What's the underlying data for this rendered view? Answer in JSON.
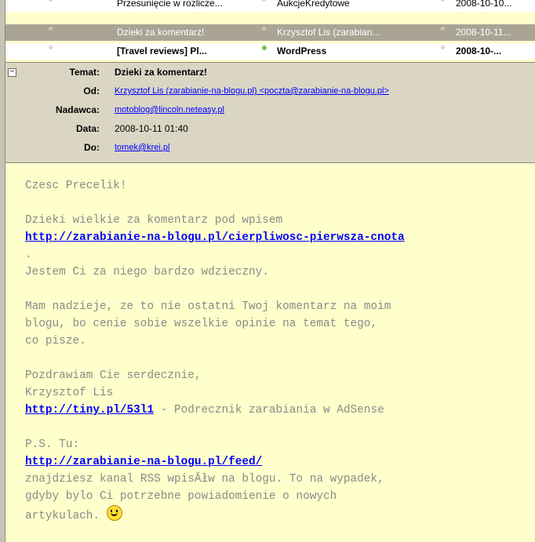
{
  "message_list": [
    {
      "subject": "Przesunięcie w rozlicze...",
      "from": "AukcjeKredytowe",
      "date": "2008-10-10...",
      "unread": false
    },
    {
      "subject": "Dzieki za komentarz!",
      "from": "Krzysztof Lis (zarabian...",
      "date": "2008-10-11...",
      "selected": true
    },
    {
      "subject": "[Travel reviews] Pl...",
      "from": "WordPress",
      "date": "2008-10-...",
      "unread": true
    }
  ],
  "header": {
    "temat_label": "Temat:",
    "temat": "Dzieki za komentarz!",
    "od_label": "Od:",
    "od": "Krzysztof Lis (zarabianie-na-blogu.pl) <poczta@zarabianie-na-blogu.pl>",
    "nadawca_label": "Nadawca:",
    "nadawca": "motoblog@lincoln.neteasy.pl",
    "data_label": "Data:",
    "data": "2008-10-11 01:40",
    "do_label": "Do:",
    "do": "tomek@krei.pl"
  },
  "body": {
    "l1": "Czesc Precelik!",
    "l2": "Dzieki wielkie za komentarz pod wpisem",
    "link1": "http://zarabianie-na-blogu.pl/cierpliwosc-pierwsza-cnota",
    "l3": ".",
    "l4": "Jestem Ci za niego bardzo wdzieczny.",
    "l5": "Mam nadzieje, ze to nie ostatni Twoj komentarz na moim",
    "l6": "blogu, bo cenie sobie wszelkie opinie na temat tego,",
    "l7": "co pisze.",
    "l8": "Pozdrawiam Cie serdecznie,",
    "l9": "Krzysztof Lis",
    "link2": "http://tiny.pl/53l1",
    "l10": " - Podrecznik zarabiania w AdSense",
    "l11": "P.S. Tu:",
    "link3": "http://zarabianie-na-blogu.pl/feed/",
    "l12": "znajdziesz kanal RSS wpisĂłw na blogu. To na wypadek,",
    "l13": "gdyby bylo Ci potrzebne powiadomienie o nowych",
    "l14": "artykulach. "
  },
  "icons": {
    "smiley": "smiley-icon",
    "collapse": "collapse-minus-icon"
  }
}
